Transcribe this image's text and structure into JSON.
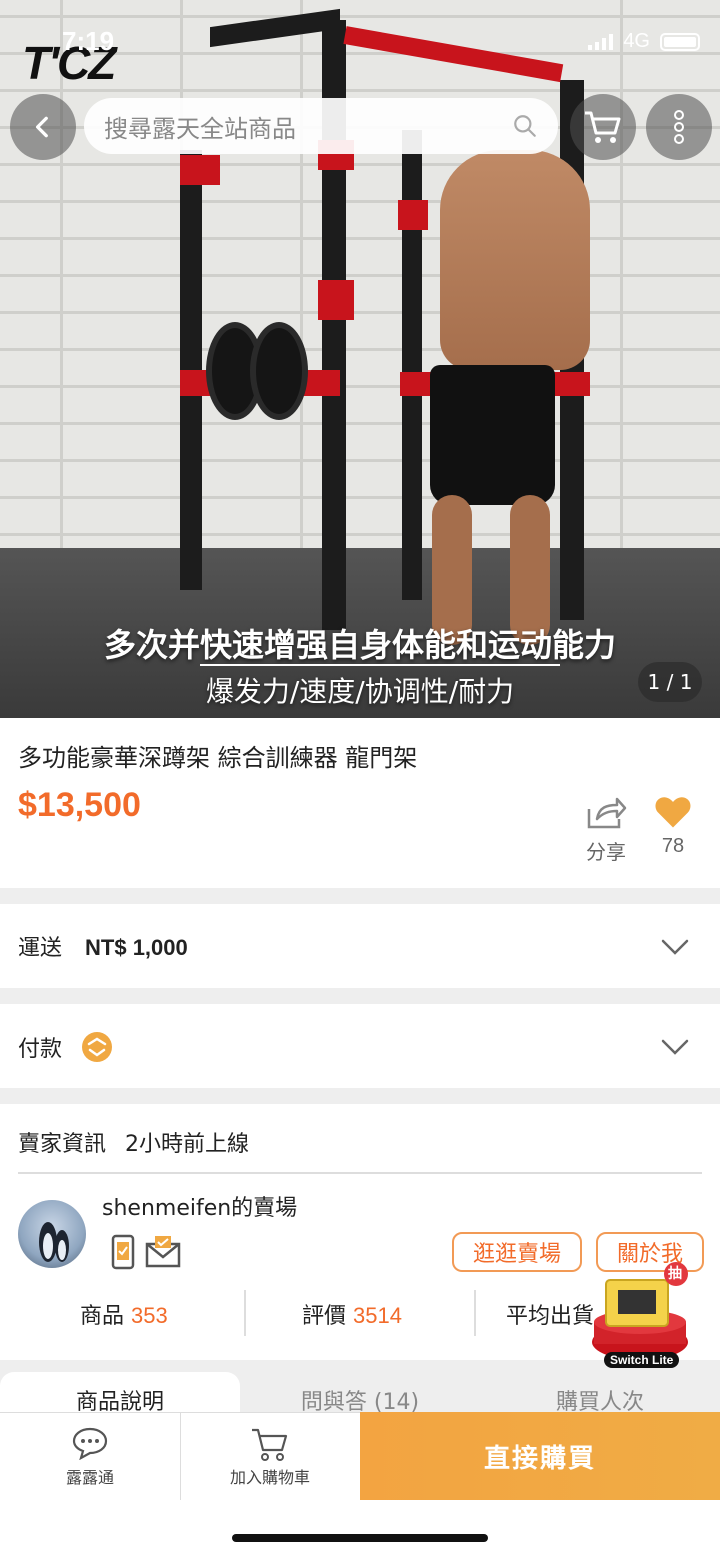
{
  "status_bar": {
    "time": "7:19",
    "network": "4G"
  },
  "hero": {
    "logo_text": "T'CZ",
    "overlay_line1": "多次并快速增强自身体能和运动能力",
    "overlay_line2": "爆发力/速度/协调性/耐力",
    "page_indicator": "1 / 1"
  },
  "search": {
    "placeholder": "搜尋露天全站商品"
  },
  "product": {
    "title": "多功能豪華深蹲架 綜合訓練器 龍門架",
    "price": "$13,500",
    "share_label": "分享",
    "favorite_count": "78"
  },
  "shipping": {
    "label": "運送",
    "value": "NT$ 1,000"
  },
  "payment": {
    "label": "付款"
  },
  "seller": {
    "header": "賣家資訊",
    "online_status": "2小時前上線",
    "shop_name": "shenmeifen的賣場",
    "visit_button": "逛逛賣場",
    "about_button": "關於我",
    "stats": [
      {
        "label": "商品",
        "value": "353"
      },
      {
        "label": "評價",
        "value": "3514"
      },
      {
        "label": "平均出貨",
        "value": ""
      }
    ]
  },
  "promo": {
    "badge": "抽",
    "caption": "Switch Lite"
  },
  "tabs": [
    "商品說明",
    "問與答 (14)",
    "購買人次"
  ],
  "bottom_bar": {
    "chat_label": "露露通",
    "cart_label": "加入購物車",
    "buy_label": "直接購買"
  },
  "colors": {
    "accent": "#f26b2a",
    "buy_button": "#f0a842"
  }
}
